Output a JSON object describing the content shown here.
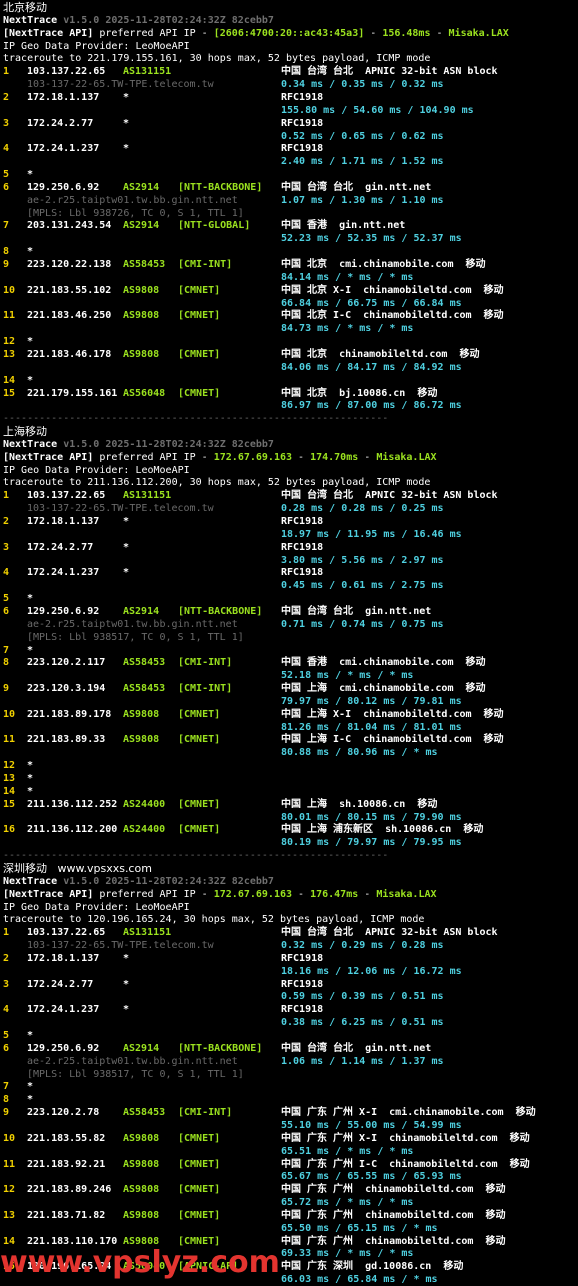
{
  "sections": [
    {
      "title": "北京移动",
      "version_line": "v1.5.0 2025-11-28T02:24:32Z 82cebb7",
      "api_ip": "[2606:4700:20::ac43:45a3]",
      "api_latency": "156.48ms",
      "api_host": "Misaka.LAX",
      "geo_provider": "IP Geo Data Provider: LeoMoeAPI",
      "traceroute": "traceroute to 221.179.155.161, 30 hops max, 52 bytes payload, ICMP mode",
      "hops": [
        {
          "n": "1",
          "ip": "103.137.22.65",
          "asn": "AS131151",
          "tag": "",
          "geo": "中国 台湾 台北",
          "host": "APNIC 32-bit ASN block",
          "sub": "103-137-22-65.TW-TPE.telecom.tw",
          "rtt": "0.34 ms / 0.35 ms / 0.32 ms"
        },
        {
          "n": "2",
          "ip": "172.18.1.137",
          "asn": "*",
          "tag": "",
          "geo": "RFC1918",
          "host": "",
          "sub": "",
          "rtt": "155.80 ms / 54.60 ms / 104.90 ms"
        },
        {
          "n": "3",
          "ip": "172.24.2.77",
          "asn": "*",
          "tag": "",
          "geo": "RFC1918",
          "host": "",
          "sub": "",
          "rtt": "0.52 ms / 0.65 ms / 0.62 ms"
        },
        {
          "n": "4",
          "ip": "172.24.1.237",
          "asn": "*",
          "tag": "",
          "geo": "RFC1918",
          "host": "",
          "sub": "",
          "rtt": "2.40 ms / 1.71 ms / 1.52 ms"
        },
        {
          "n": "5",
          "ip": "*",
          "asn": "",
          "tag": "",
          "geo": "",
          "host": "",
          "sub": "",
          "rtt": ""
        },
        {
          "n": "6",
          "ip": "129.250.6.92",
          "asn": "AS2914",
          "tag": "[NTT-BACKBONE]",
          "geo": "中国 台湾 台北",
          "host": "gin.ntt.net",
          "sub": "ae-2.r25.taiptw01.tw.bb.gin.ntt.net",
          "sub2": "[MPLS: Lbl 938726, TC 0, S 1, TTL 1]",
          "rtt": "1.07 ms / 1.30 ms / 1.10 ms"
        },
        {
          "n": "7",
          "ip": "203.131.243.54",
          "asn": "AS2914",
          "tag": "[NTT-GLOBAL]",
          "geo": "中国 香港",
          "host": "gin.ntt.net",
          "sub": "",
          "rtt": "52.23 ms / 52.35 ms / 52.37 ms"
        },
        {
          "n": "8",
          "ip": "*",
          "asn": "",
          "tag": "",
          "geo": "",
          "host": "",
          "sub": "",
          "rtt": ""
        },
        {
          "n": "9",
          "ip": "223.120.22.138",
          "asn": "AS58453",
          "tag": "[CMI-INT]",
          "geo": "中国 北京",
          "host": "cmi.chinamobile.com  移动",
          "sub": "",
          "rtt": "84.14 ms / * ms / * ms"
        },
        {
          "n": "10",
          "ip": "221.183.55.102",
          "asn": "AS9808",
          "tag": "[CMNET]",
          "geo": "中国 北京 X-I",
          "host": "chinamobileltd.com  移动",
          "sub": "",
          "rtt": "66.84 ms / 66.75 ms / 66.84 ms"
        },
        {
          "n": "11",
          "ip": "221.183.46.250",
          "asn": "AS9808",
          "tag": "[CMNET]",
          "geo": "中国 北京 I-C",
          "host": "chinamobileltd.com  移动",
          "sub": "",
          "rtt": "84.73 ms / * ms / * ms"
        },
        {
          "n": "12",
          "ip": "*",
          "asn": "",
          "tag": "",
          "geo": "",
          "host": "",
          "sub": "",
          "rtt": ""
        },
        {
          "n": "13",
          "ip": "221.183.46.178",
          "asn": "AS9808",
          "tag": "[CMNET]",
          "geo": "中国 北京",
          "host": "chinamobileltd.com  移动",
          "sub": "",
          "rtt": "84.06 ms / 84.17 ms / 84.92 ms"
        },
        {
          "n": "14",
          "ip": "*",
          "asn": "",
          "tag": "",
          "geo": "",
          "host": "",
          "sub": "",
          "rtt": ""
        },
        {
          "n": "15",
          "ip": "221.179.155.161",
          "asn": "AS56048",
          "tag": "[CMNET]",
          "geo": "中国 北京",
          "host": "bj.10086.cn  移动",
          "sub": "",
          "rtt": "86.97 ms / 87.00 ms / 86.72 ms"
        }
      ]
    },
    {
      "title": "上海移动",
      "version_line": "v1.5.0 2025-11-28T02:24:32Z 82cebb7",
      "api_ip": "172.67.69.163",
      "api_latency": "174.70ms",
      "api_host": "Misaka.LAX",
      "geo_provider": "IP Geo Data Provider: LeoMoeAPI",
      "traceroute": "traceroute to 211.136.112.200, 30 hops max, 52 bytes payload, ICMP mode",
      "hops": [
        {
          "n": "1",
          "ip": "103.137.22.65",
          "asn": "AS131151",
          "tag": "",
          "geo": "中国 台湾 台北",
          "host": "APNIC 32-bit ASN block",
          "sub": "103-137-22-65.TW-TPE.telecom.tw",
          "rtt": "0.28 ms / 0.28 ms / 0.25 ms"
        },
        {
          "n": "2",
          "ip": "172.18.1.137",
          "asn": "*",
          "tag": "",
          "geo": "RFC1918",
          "host": "",
          "sub": "",
          "rtt": "18.97 ms / 11.95 ms / 16.46 ms"
        },
        {
          "n": "3",
          "ip": "172.24.2.77",
          "asn": "*",
          "tag": "",
          "geo": "RFC1918",
          "host": "",
          "sub": "",
          "rtt": "3.80 ms / 5.56 ms / 2.97 ms"
        },
        {
          "n": "4",
          "ip": "172.24.1.237",
          "asn": "*",
          "tag": "",
          "geo": "RFC1918",
          "host": "",
          "sub": "",
          "rtt": "0.45 ms / 0.61 ms / 2.75 ms"
        },
        {
          "n": "5",
          "ip": "*",
          "asn": "",
          "tag": "",
          "geo": "",
          "host": "",
          "sub": "",
          "rtt": ""
        },
        {
          "n": "6",
          "ip": "129.250.6.92",
          "asn": "AS2914",
          "tag": "[NTT-BACKBONE]",
          "geo": "中国 台湾 台北",
          "host": "gin.ntt.net",
          "sub": "ae-2.r25.taiptw01.tw.bb.gin.ntt.net",
          "sub2": "[MPLS: Lbl 938517, TC 0, S 1, TTL 1]",
          "rtt": "0.71 ms / 0.74 ms / 0.75 ms"
        },
        {
          "n": "7",
          "ip": "*",
          "asn": "",
          "tag": "",
          "geo": "",
          "host": "",
          "sub": "",
          "rtt": ""
        },
        {
          "n": "8",
          "ip": "223.120.2.117",
          "asn": "AS58453",
          "tag": "[CMI-INT]",
          "geo": "中国 香港",
          "host": "cmi.chinamobile.com  移动",
          "sub": "",
          "rtt": "52.18 ms / * ms / * ms"
        },
        {
          "n": "9",
          "ip": "223.120.3.194",
          "asn": "AS58453",
          "tag": "[CMI-INT]",
          "geo": "中国 上海",
          "host": "cmi.chinamobile.com  移动",
          "sub": "",
          "rtt": "79.97 ms / 80.12 ms / 79.81 ms"
        },
        {
          "n": "10",
          "ip": "221.183.89.178",
          "asn": "AS9808",
          "tag": "[CMNET]",
          "geo": "中国 上海 X-I",
          "host": "chinamobileltd.com  移动",
          "sub": "",
          "rtt": "81.26 ms / 81.04 ms / 81.01 ms"
        },
        {
          "n": "11",
          "ip": "221.183.89.33",
          "asn": "AS9808",
          "tag": "[CMNET]",
          "geo": "中国 上海 I-C",
          "host": "chinamobileltd.com  移动",
          "sub": "",
          "rtt": "80.88 ms / 80.96 ms / * ms"
        },
        {
          "n": "12",
          "ip": "*",
          "asn": "",
          "tag": "",
          "geo": "",
          "host": "",
          "sub": "",
          "rtt": ""
        },
        {
          "n": "13",
          "ip": "*",
          "asn": "",
          "tag": "",
          "geo": "",
          "host": "",
          "sub": "",
          "rtt": ""
        },
        {
          "n": "14",
          "ip": "*",
          "asn": "",
          "tag": "",
          "geo": "",
          "host": "",
          "sub": "",
          "rtt": ""
        },
        {
          "n": "15",
          "ip": "211.136.112.252",
          "asn": "AS24400",
          "tag": "[CMNET]",
          "geo": "中国 上海",
          "host": "sh.10086.cn  移动",
          "sub": "",
          "rtt": "80.01 ms / 80.15 ms / 79.90 ms"
        },
        {
          "n": "16",
          "ip": "211.136.112.200",
          "asn": "AS24400",
          "tag": "[CMNET]",
          "geo": "中国 上海 浦东新区",
          "host": "sh.10086.cn  移动",
          "sub": "",
          "rtt": "80.19 ms / 79.97 ms / 79.95 ms"
        }
      ]
    },
    {
      "title": "深圳移动   www.vpsxxs.com",
      "version_line": "v1.5.0 2025-11-28T02:24:32Z 82cebb7",
      "api_ip": "172.67.69.163",
      "api_latency": "176.47ms",
      "api_host": "Misaka.LAX",
      "geo_provider": "IP Geo Data Provider: LeoMoeAPI",
      "traceroute": "traceroute to 120.196.165.24, 30 hops max, 52 bytes payload, ICMP mode",
      "hops": [
        {
          "n": "1",
          "ip": "103.137.22.65",
          "asn": "AS131151",
          "tag": "",
          "geo": "中国 台湾 台北",
          "host": "APNIC 32-bit ASN block",
          "sub": "103-137-22-65.TW-TPE.telecom.tw",
          "rtt": "0.32 ms / 0.29 ms / 0.28 ms"
        },
        {
          "n": "2",
          "ip": "172.18.1.137",
          "asn": "*",
          "tag": "",
          "geo": "RFC1918",
          "host": "",
          "sub": "",
          "rtt": "18.16 ms / 12.06 ms / 16.72 ms"
        },
        {
          "n": "3",
          "ip": "172.24.2.77",
          "asn": "*",
          "tag": "",
          "geo": "RFC1918",
          "host": "",
          "sub": "",
          "rtt": "0.59 ms / 0.39 ms / 0.51 ms"
        },
        {
          "n": "4",
          "ip": "172.24.1.237",
          "asn": "*",
          "tag": "",
          "geo": "RFC1918",
          "host": "",
          "sub": "",
          "rtt": "0.38 ms / 6.25 ms / 0.51 ms"
        },
        {
          "n": "5",
          "ip": "*",
          "asn": "",
          "tag": "",
          "geo": "",
          "host": "",
          "sub": "",
          "rtt": ""
        },
        {
          "n": "6",
          "ip": "129.250.6.92",
          "asn": "AS2914",
          "tag": "[NTT-BACKBONE]",
          "geo": "中国 台湾 台北",
          "host": "gin.ntt.net",
          "sub": "ae-2.r25.taiptw01.tw.bb.gin.ntt.net",
          "sub2": "[MPLS: Lbl 938517, TC 0, S 1, TTL 1]",
          "rtt": "1.06 ms / 1.14 ms / 1.37 ms"
        },
        {
          "n": "7",
          "ip": "*",
          "asn": "",
          "tag": "",
          "geo": "",
          "host": "",
          "sub": "",
          "rtt": ""
        },
        {
          "n": "8",
          "ip": "*",
          "asn": "",
          "tag": "",
          "geo": "",
          "host": "",
          "sub": "",
          "rtt": ""
        },
        {
          "n": "9",
          "ip": "223.120.2.78",
          "asn": "AS58453",
          "tag": "[CMI-INT]",
          "geo": "中国 广东 广州 X-I",
          "host": "cmi.chinamobile.com  移动",
          "sub": "",
          "rtt": "55.10 ms / 55.00 ms / 54.99 ms"
        },
        {
          "n": "10",
          "ip": "221.183.55.82",
          "asn": "AS9808",
          "tag": "[CMNET]",
          "geo": "中国 广东 广州 X-I",
          "host": "chinamobileltd.com  移动",
          "sub": "",
          "rtt": "65.51 ms / * ms / * ms"
        },
        {
          "n": "11",
          "ip": "221.183.92.21",
          "asn": "AS9808",
          "tag": "[CMNET]",
          "geo": "中国 广东 广州 I-C",
          "host": "chinamobileltd.com  移动",
          "sub": "",
          "rtt": "65.67 ms / 65.55 ms / 65.93 ms"
        },
        {
          "n": "12",
          "ip": "221.183.89.246",
          "asn": "AS9808",
          "tag": "[CMNET]",
          "geo": "中国 广东 广州",
          "host": "chinamobileltd.com  移动",
          "sub": "",
          "rtt": "65.72 ms / * ms / * ms"
        },
        {
          "n": "13",
          "ip": "221.183.71.82",
          "asn": "AS9808",
          "tag": "[CMNET]",
          "geo": "中国 广东 广州",
          "host": "chinamobileltd.com  移动",
          "sub": "",
          "rtt": "65.50 ms / 65.15 ms / * ms"
        },
        {
          "n": "14",
          "ip": "221.183.110.170",
          "asn": "AS9808",
          "tag": "[CMNET]",
          "geo": "中国 广东 广州",
          "host": "chinamobileltd.com  移动",
          "sub": "",
          "rtt": "69.33 ms / * ms / * ms"
        },
        {
          "n": "15",
          "ip": "120.196.165.24",
          "asn": "AS56040",
          "tag": "[APNIC-AP]",
          "geo": "中国 广东 深圳",
          "host": "gd.10086.cn  移动",
          "sub": "",
          "rtt": "66.03 ms / 65.84 ms / * ms"
        }
      ]
    }
  ],
  "labels": {
    "nexttrace": "NextTrace",
    "api_prefix": "[NextTrace API]",
    "api_text": " preferred API IP - ",
    "separator": "----------------------------------------------------------------"
  },
  "watermark": "www.vpslyz.com"
}
